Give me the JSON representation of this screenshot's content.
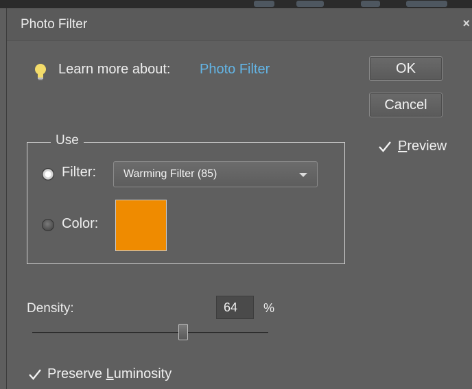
{
  "window": {
    "title": "Photo Filter",
    "close_glyph": "×"
  },
  "learn_more": {
    "label": "Learn more about:",
    "link": "Photo Filter",
    "icon": "lightbulb-icon"
  },
  "buttons": {
    "ok": "OK",
    "cancel": "Cancel"
  },
  "preview": {
    "label_mnemonic": "P",
    "label_rest": "review",
    "checked": true
  },
  "use_group": {
    "title": "Use",
    "filter_label": "Filter:",
    "filter_selected": true,
    "filter_value": "Warming Filter (85)",
    "color_label": "Color:",
    "color_selected": false,
    "color_swatch": "#ef8b00"
  },
  "density": {
    "label": "Density:",
    "value": "64",
    "unit": "%",
    "level": 0.64
  },
  "preserve_luminosity": {
    "label_before": "Preserve ",
    "label_mnemonic": "L",
    "label_rest": "uminosity",
    "checked": true
  },
  "colors": {
    "link": "#63b5e6",
    "bulb": "#f3dc6a"
  }
}
